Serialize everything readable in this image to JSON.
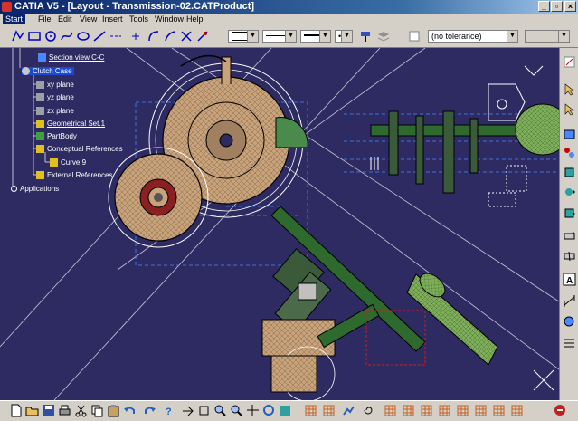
{
  "window": {
    "title": "CATIA V5 - [Layout - Transmission-02.CATProduct]",
    "minimize": "_",
    "restore": "▫",
    "close": "×"
  },
  "menu": [
    "Start",
    "File",
    "Edit",
    "View",
    "Insert",
    "Tools",
    "Window",
    "Help"
  ],
  "toolbar": {
    "tolerance_value": "(no tolerance)"
  },
  "tree": {
    "items": [
      {
        "label": "Section view C-C"
      },
      {
        "label": "Clutch Case"
      },
      {
        "label": "xy plane"
      },
      {
        "label": "yz plane"
      },
      {
        "label": "zx plane"
      },
      {
        "label": "Geometrical Set.1"
      },
      {
        "label": "PartBody"
      },
      {
        "label": "Conceptual References"
      },
      {
        "label": "Curve.9"
      },
      {
        "label": "External References"
      },
      {
        "label": "Applications"
      }
    ]
  },
  "colors": {
    "background": "#2e2a62",
    "gear_fill": "#c8a27a",
    "green_part": "#7fae5a",
    "highlight": "#ffffff"
  }
}
